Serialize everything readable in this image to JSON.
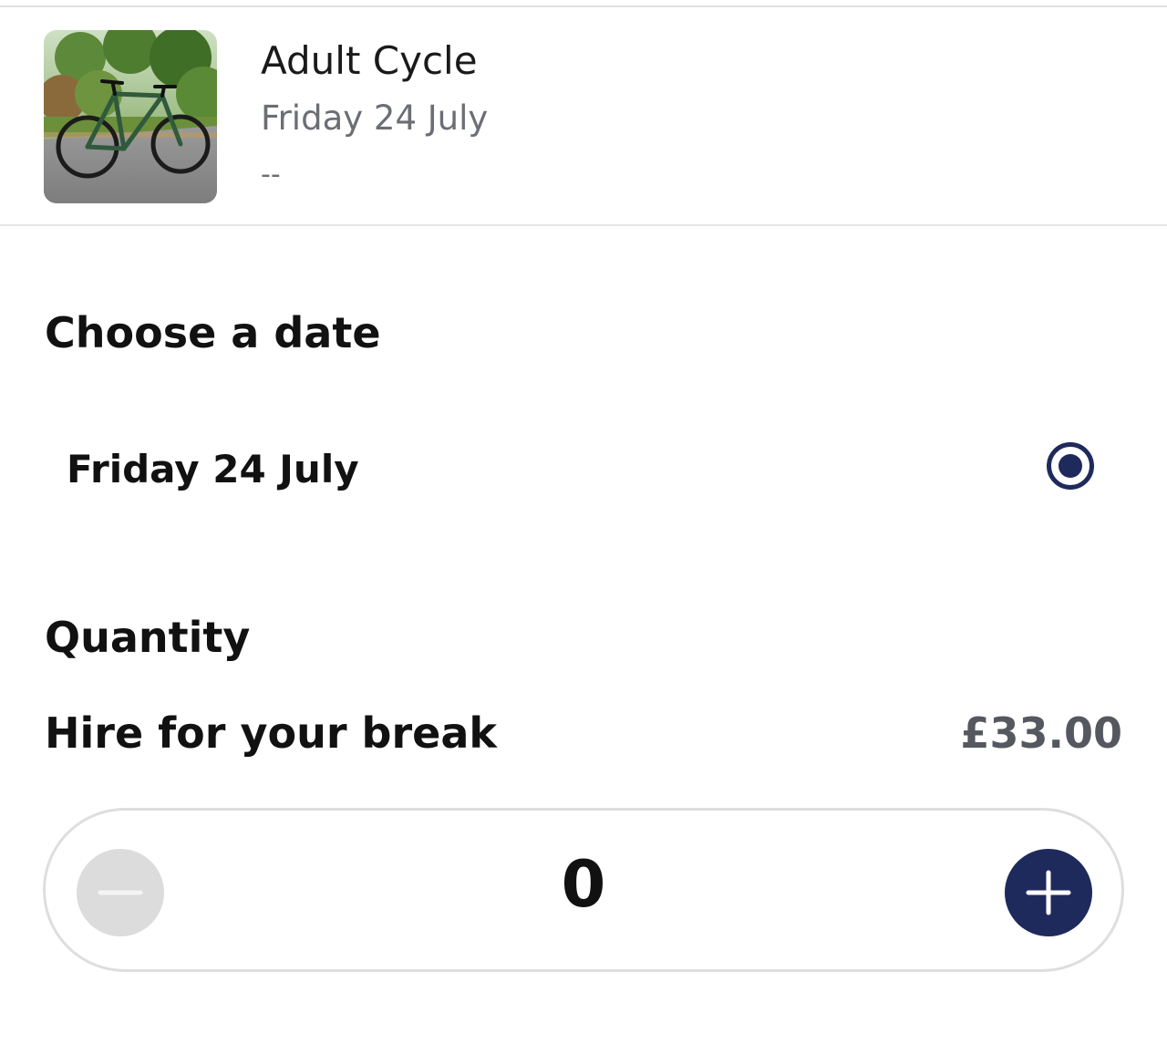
{
  "product": {
    "title": "Adult Cycle",
    "date": "Friday 24 July",
    "time": "--",
    "image_icon": "bicycle-photo"
  },
  "date_section": {
    "heading": "Choose a date",
    "options": [
      {
        "label": "Friday 24 July",
        "selected": true
      }
    ]
  },
  "quantity_section": {
    "heading": "Quantity",
    "item_label": "Hire for your break",
    "price": "£33.00",
    "value": "0",
    "minus_icon": "minus-icon",
    "plus_icon": "plus-icon"
  },
  "colors": {
    "accent": "#1f2a5c",
    "disabled": "#dcdcdc",
    "muted_text": "#6b6e74"
  }
}
